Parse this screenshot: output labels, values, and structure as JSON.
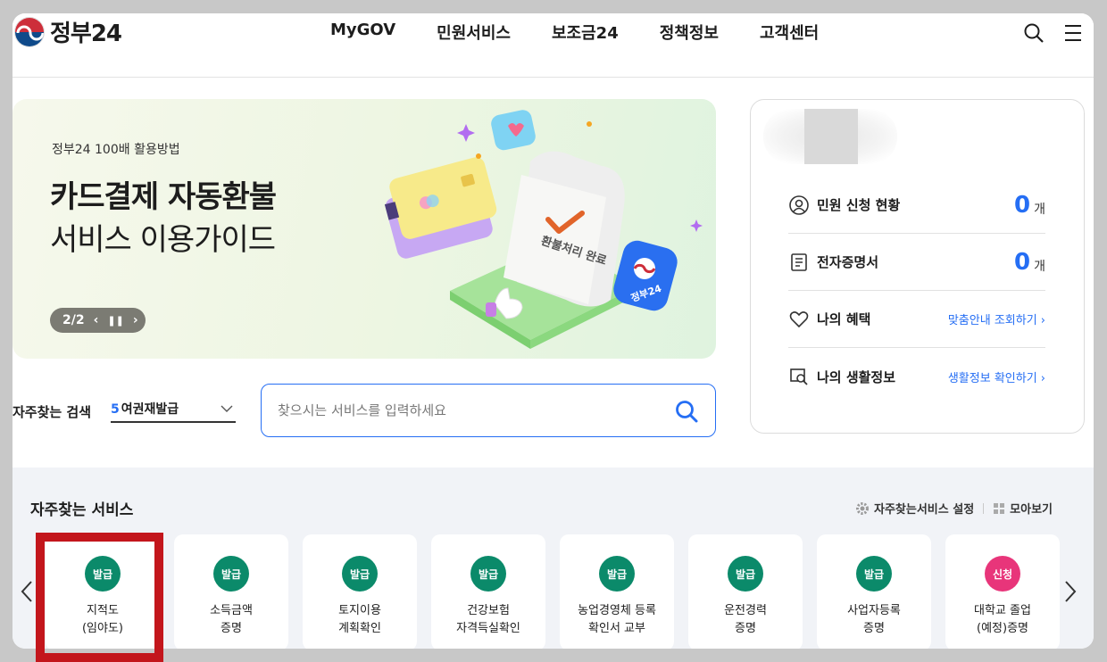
{
  "header": {
    "logo_text": "정부24",
    "nav": [
      "MyGOV",
      "민원서비스",
      "보조금24",
      "정책정보",
      "고객센터"
    ],
    "icons": [
      "search-icon",
      "menu-icon"
    ]
  },
  "banner": {
    "subtitle": "정부24 100배 활용방법",
    "title_bold": "카드결제 자동환불",
    "title_light": "서비스 이용가이드",
    "pager": "2/2",
    "illus_label_receipt": "환불처리 완료",
    "illus_label_badge": "정부24"
  },
  "search": {
    "freq_label": "자주찾는 검색",
    "freq_num": "5",
    "freq_value": "여권재발급",
    "placeholder": "찾으시는 서비스를 입력하세요"
  },
  "side": {
    "rows": [
      {
        "label": "민원 신청 현황",
        "count": "0",
        "unit": "개"
      },
      {
        "label": "전자증명서",
        "count": "0",
        "unit": "개"
      },
      {
        "label": "나의 혜택",
        "link": "맞춤안내 조회하기"
      },
      {
        "label": "나의 생활정보",
        "link": "생활정보 확인하기"
      }
    ]
  },
  "services": {
    "title": "자주찾는 서비스",
    "settings_label": "자주찾는서비스 설정",
    "view_all_label": "모아보기",
    "colors": {
      "issue": "#0b8a6a",
      "apply": "#e8357a"
    },
    "cards": [
      {
        "badge": "발급",
        "type": "issue",
        "line1": "지적도",
        "line2": "(임야도)"
      },
      {
        "badge": "발급",
        "type": "issue",
        "line1": "소득금액",
        "line2": "증명"
      },
      {
        "badge": "발급",
        "type": "issue",
        "line1": "토지이용",
        "line2": "계획확인"
      },
      {
        "badge": "발급",
        "type": "issue",
        "line1": "건강보험",
        "line2": "자격득실확인"
      },
      {
        "badge": "발급",
        "type": "issue",
        "line1": "농업경영체 등록",
        "line2": "확인서 교부"
      },
      {
        "badge": "발급",
        "type": "issue",
        "line1": "운전경력",
        "line2": "증명"
      },
      {
        "badge": "발급",
        "type": "issue",
        "line1": "사업자등록",
        "line2": "증명"
      },
      {
        "badge": "신청",
        "type": "apply",
        "line1": "대학교 졸업",
        "line2": "(예정)증명"
      }
    ]
  }
}
